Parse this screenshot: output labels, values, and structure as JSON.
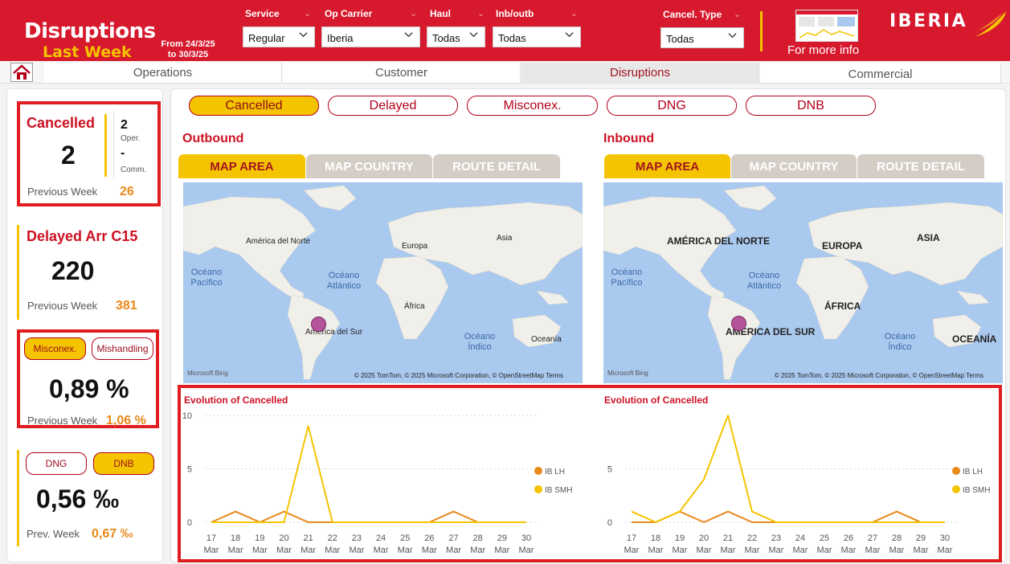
{
  "header": {
    "title_line1": "Disruptions",
    "title_line2": "Last Week",
    "date_line1": "From 24/3/25",
    "date_line2": "to 30/3/25",
    "more_info": "For more info",
    "brand": "IBERIA",
    "filters": [
      {
        "label": "Service",
        "value": "Regular"
      },
      {
        "label": "Op Carrier",
        "value": "Iberia"
      },
      {
        "label": "Haul",
        "value": "Todas"
      },
      {
        "label": "Inb/outb",
        "value": "Todas"
      },
      {
        "label": "Cancel. Type",
        "value": "Todas"
      }
    ]
  },
  "nav_tabs": [
    "Operations",
    "Customer",
    "Disruptions",
    "Commercial"
  ],
  "kpis": {
    "cancelled": {
      "title": "Cancelled",
      "value": "2",
      "oper_value": "2",
      "oper_label": "Oper.",
      "comm_value": "-",
      "comm_label": "Comm.",
      "prev_label": "Previous Week",
      "prev_value": "26"
    },
    "delayed": {
      "title": "Delayed Arr C15",
      "value": "220",
      "prev_label": "Previous Week",
      "prev_value": "381"
    },
    "misconex": {
      "pill_a": "Misconex.",
      "pill_b": "Mishandling",
      "value": "0,89 %",
      "prev_label": "Previous Week",
      "prev_value": "1,06 %"
    },
    "dng": {
      "pill_a": "DNG",
      "pill_b": "DNB",
      "value": "0,56 ‰",
      "prev_label": "Prev. Week",
      "prev_value": "0,67 ‰"
    }
  },
  "main_pills": [
    "Cancelled",
    "Delayed",
    "Misconex.",
    "DNG",
    "DNB"
  ],
  "outbound": {
    "title": "Outbound",
    "map_tabs": [
      "MAP AREA",
      "MAP COUNTRY",
      "ROUTE DETAIL"
    ],
    "map": {
      "labels": [
        "América del Norte",
        "Europa",
        "Asia",
        "África",
        "América del Sur",
        "Oceanía"
      ],
      "oceans": [
        "Océano Pacífico",
        "Océano Atlántico",
        "Océano Índico"
      ],
      "bing": "Microsoft Bing",
      "copyright": "© 2025 TomTom, © 2025 Microsoft Corporation, © OpenStreetMap  Terms"
    }
  },
  "inbound": {
    "title": "Inbound",
    "map_tabs": [
      "MAP AREA",
      "MAP COUNTRY",
      "ROUTE DETAIL"
    ],
    "map": {
      "labels": [
        "AMÉRICA DEL NORTE",
        "EUROPA",
        "ASIA",
        "ÁFRICA",
        "AMÉRICA DEL SUR",
        "OCEANÍA"
      ],
      "oceans": [
        "Océano Pacífico",
        "Océano Atlántico",
        "Océano Índico"
      ],
      "bing": "Microsoft Bing",
      "copyright": "© 2025 TomTom, © 2025 Microsoft Corporation, © OpenStreetMap  Terms"
    }
  },
  "chart_data": [
    {
      "type": "line",
      "title": "Evolution of Cancelled",
      "x": [
        "17 Mar",
        "18 Mar",
        "19 Mar",
        "20 Mar",
        "21 Mar",
        "22 Mar",
        "23 Mar",
        "24 Mar",
        "25 Mar",
        "26 Mar",
        "27 Mar",
        "28 Mar",
        "29 Mar",
        "30 Mar"
      ],
      "yticks": [
        0,
        5,
        10
      ],
      "ylim": [
        0,
        10
      ],
      "grid": true,
      "legend": "right",
      "series": [
        {
          "name": "IB LH",
          "color": "#e8891a",
          "values": [
            0,
            1,
            0,
            1,
            0,
            0,
            0,
            0,
            0,
            0,
            1,
            0,
            0,
            0
          ]
        },
        {
          "name": "IB SMH",
          "color": "#f5c400",
          "values": [
            0,
            0,
            0,
            0,
            9,
            0,
            0,
            0,
            0,
            0,
            0,
            0,
            0,
            0
          ]
        }
      ]
    },
    {
      "type": "line",
      "title": "Evolution of Cancelled",
      "x": [
        "17 Mar",
        "18 Mar",
        "19 Mar",
        "20 Mar",
        "21 Mar",
        "22 Mar",
        "23 Mar",
        "24 Mar",
        "25 Mar",
        "26 Mar",
        "27 Mar",
        "28 Mar",
        "29 Mar",
        "30 Mar"
      ],
      "yticks": [
        0,
        5
      ],
      "ylim": [
        0,
        10
      ],
      "grid": true,
      "legend": "right",
      "series": [
        {
          "name": "IB LH",
          "color": "#e8891a",
          "values": [
            0,
            0,
            1,
            0,
            1,
            0,
            0,
            0,
            0,
            0,
            0,
            1,
            0,
            0
          ]
        },
        {
          "name": "IB SMH",
          "color": "#f5c400",
          "values": [
            1,
            0,
            1,
            4,
            10,
            1,
            0,
            0,
            0,
            0,
            0,
            0,
            0,
            0
          ]
        }
      ]
    }
  ]
}
